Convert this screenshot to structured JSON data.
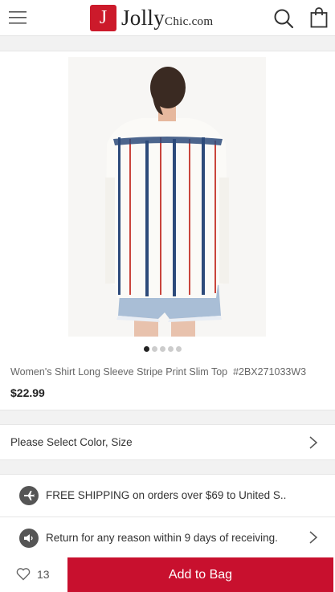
{
  "header": {
    "logo_letter": "J",
    "logo_text_main": "Jolly",
    "logo_text_brand": "Chic",
    "logo_text_domain": ".com",
    "icons": [
      "menu-icon",
      "search-icon",
      "bag-icon"
    ]
  },
  "product": {
    "title": "Women's Shirt Long Sleeve Stripe Print Slim Top",
    "sku": "#2BX271033W3",
    "price": "$22.99",
    "image_count": 5,
    "active_image": 1
  },
  "options": {
    "select_label": "Please Select Color, Size"
  },
  "info": {
    "shipping": "FREE SHIPPING on orders over $69 to United S..",
    "returns": "Return for any reason within 9 days of receiving."
  },
  "bottom": {
    "favorite_count": "13",
    "add_to_bag": "Add to Bag"
  },
  "colors": {
    "brand": "#cc1a2b",
    "button": "#c8102e"
  }
}
